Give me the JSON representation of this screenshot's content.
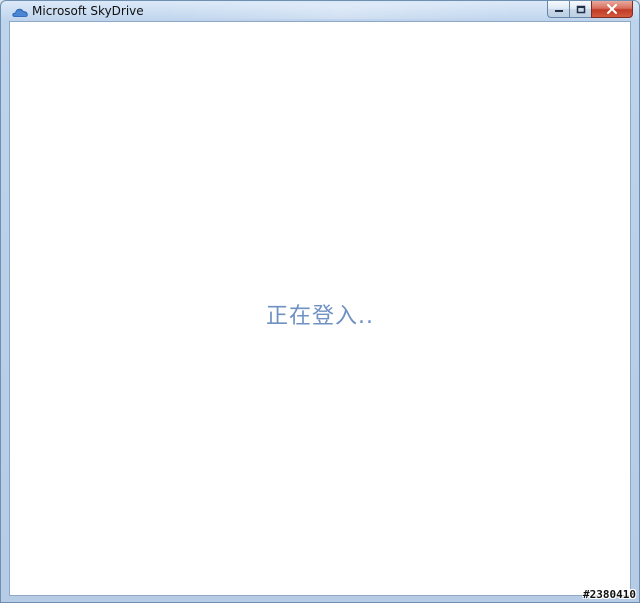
{
  "window": {
    "title": "Microsoft SkyDrive",
    "icon": "skydrive-cloud-icon",
    "controls": {
      "minimize": "minimize-icon",
      "maximize": "maximize-icon",
      "close": "close-icon"
    }
  },
  "content": {
    "status_text": "正在登入.."
  },
  "watermark": {
    "text": "#2380410"
  },
  "colors": {
    "status_text": "#6f91c3",
    "titlebar": "#b5cbe6",
    "close_button": "#c13b26"
  }
}
